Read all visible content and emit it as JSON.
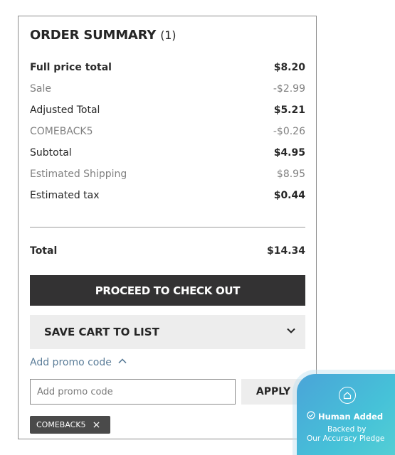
{
  "summary": {
    "title": "ORDER SUMMARY",
    "count": "(1)",
    "lines": [
      {
        "label": "Full price total",
        "value": "$8.20"
      },
      {
        "label": "Sale",
        "value": "-$2.99"
      },
      {
        "label": "Adjusted Total",
        "value": "$5.21"
      },
      {
        "label": "COMEBACK5",
        "value": "-$0.26"
      },
      {
        "label": "Subtotal",
        "value": "$4.95"
      },
      {
        "label": "Estimated Shipping",
        "value": "$8.95"
      },
      {
        "label": "Estimated tax",
        "value": "$0.44"
      }
    ],
    "total": {
      "label": "Total",
      "value": "$14.34"
    }
  },
  "actions": {
    "checkout_label": "PROCEED TO CHECK OUT",
    "save_cart_label": "SAVE CART TO LIST"
  },
  "promo": {
    "toggle_label": "Add promo code",
    "input_placeholder": "Add promo code",
    "input_value": "",
    "apply_label": "APPLY",
    "applied_code": "COMEBACK5"
  },
  "badge": {
    "headline": "Human Added",
    "line1": "Backed by",
    "line2": "Our Accuracy Pledge"
  },
  "colors": {
    "checkout_bg": "#333233",
    "promo_link": "#5b7d99",
    "muted_text": "#808080",
    "badge_gradient_start": "#4aa4d8",
    "badge_gradient_end": "#59d3d3"
  }
}
